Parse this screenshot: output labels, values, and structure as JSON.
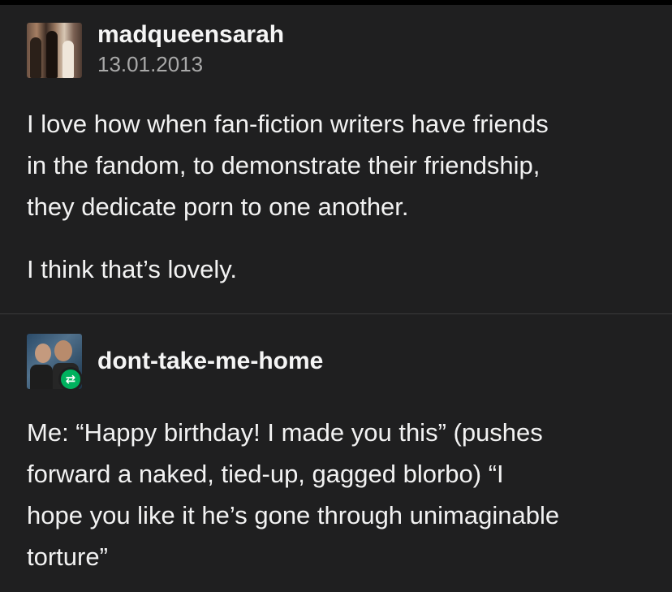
{
  "posts": [
    {
      "username": "madqueensarah",
      "date": "13.01.2013",
      "paragraphs": [
        [
          "I love how when fan-fiction writers have friends",
          "in the fandom, to demonstrate their friendship,",
          "they dedicate porn to one another."
        ],
        [
          "I think that’s lovely."
        ]
      ]
    },
    {
      "username": "dont-take-me-home",
      "reblog_icon": "reblog-icon",
      "paragraphs": [
        [
          "Me: “Happy birthday! I made you this” (pushes",
          "forward a naked, tied-up, gagged blorbo) “I",
          "hope you like it he’s gone through unimaginable",
          "torture”"
        ]
      ]
    }
  ],
  "colors": {
    "background": "#1f1f20",
    "reblog_badge": "#00b15e"
  }
}
